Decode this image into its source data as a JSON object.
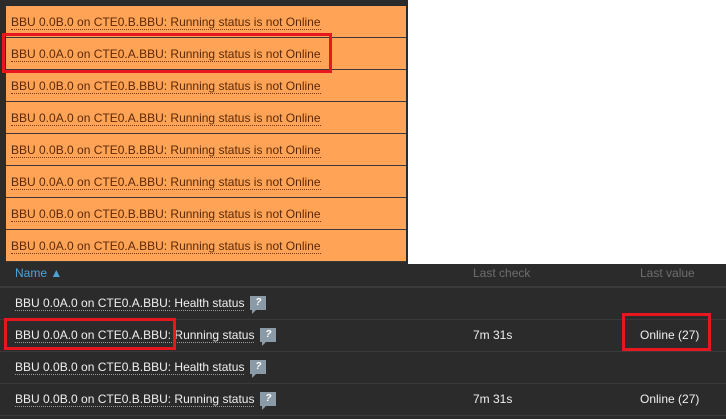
{
  "problems": [
    "BBU 0.0B.0 on CTE0.B.BBU: Running status is not Online",
    "BBU 0.0A.0 on CTE0.A.BBU: Running status is not Online",
    "BBU 0.0B.0 on CTE0.B.BBU: Running status is not Online",
    "BBU 0.0A.0 on CTE0.A.BBU: Running status is not Online",
    "BBU 0.0B.0 on CTE0.B.BBU: Running status is not Online",
    "BBU 0.0A.0 on CTE0.A.BBU: Running status is not Online",
    "BBU 0.0B.0 on CTE0.B.BBU: Running status is not Online",
    "BBU 0.0A.0 on CTE0.A.BBU: Running status is not Online"
  ],
  "table": {
    "headers": {
      "name": "Name ▲",
      "last_check": "Last check",
      "last_value": "Last value"
    },
    "help_icon": "?",
    "rows": [
      {
        "name": "BBU 0.0A.0 on CTE0.A.BBU: Health status",
        "last_check": "",
        "last_value": ""
      },
      {
        "name": "BBU 0.0A.0 on CTE0.A.BBU: Running status",
        "last_check": "7m 31s",
        "last_value": "Online (27)"
      },
      {
        "name": "BBU 0.0B.0 on CTE0.B.BBU: Health status",
        "last_check": "",
        "last_value": ""
      },
      {
        "name": "BBU 0.0B.0 on CTE0.B.BBU: Running status",
        "last_check": "7m 31s",
        "last_value": "Online (27)"
      }
    ]
  }
}
